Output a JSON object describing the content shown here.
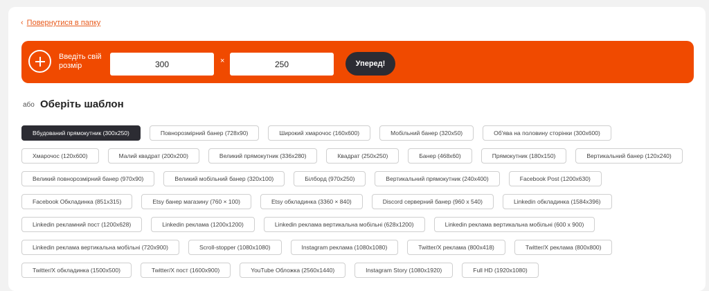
{
  "back_link": {
    "label": "Повернутися в папку",
    "chevron": "‹"
  },
  "custom_size": {
    "label_line1": "Введіть свій",
    "label_line2": "розмір",
    "width": "300",
    "height": "250",
    "separator": "×",
    "submit_label": "Уперед!"
  },
  "or_label": "або",
  "templates_title": "Оберіть шаблон",
  "colors": {
    "accent": "#f04a00",
    "dark": "#2c2c33"
  },
  "templates": [
    {
      "label": "Вбудований прямокутник (300x250)",
      "active": true
    },
    {
      "label": "Повнорозмірний банер (728x90)"
    },
    {
      "label": "Широкий хмарочос (160x600)"
    },
    {
      "label": "Мобільний банер (320x50)"
    },
    {
      "label": "Об'ява на половину сторінки (300x600)"
    },
    {
      "label": "Хмарочос (120x600)"
    },
    {
      "label": "Малий квадрат (200x200)"
    },
    {
      "label": "Великий прямокутник (336x280)"
    },
    {
      "label": "Квадрат (250x250)"
    },
    {
      "label": "Банер (468x60)"
    },
    {
      "label": "Прямокутник (180x150)"
    },
    {
      "label": "Вертикальний банер (120x240)"
    },
    {
      "label": "Великий повнорозмірний банер (970x90)"
    },
    {
      "label": "Великий мобільний банер (320x100)"
    },
    {
      "label": "Білборд (970x250)"
    },
    {
      "label": "Вертикальний прямокутник (240x400)"
    },
    {
      "label": "Facebook Post (1200x630)"
    },
    {
      "label": "Facebook Обкладинка (851x315)"
    },
    {
      "label": "Etsy банер магазину (760 × 100)"
    },
    {
      "label": "Etsy обкладинка (3360 × 840)"
    },
    {
      "label": "Discord серверний банер (960 x 540)"
    },
    {
      "label": "Linkedin обкладинка (1584x396)"
    },
    {
      "label": "Linkedin рекламний пост (1200x628)"
    },
    {
      "label": "Linkedin реклама (1200x1200)"
    },
    {
      "label": "Linkedin реклама вертикальна мобільні (628x1200)"
    },
    {
      "label": "Linkedin реклама вертикальна мобільні (600 x 900)"
    },
    {
      "label": "Linkedin реклама вертикальна мобільні (720x900)"
    },
    {
      "label": "Scroll-stopper (1080x1080)"
    },
    {
      "label": "Instagram реклама (1080x1080)"
    },
    {
      "label": "Twitter/X реклама (800x418)"
    },
    {
      "label": "Twitter/X реклама (800x800)"
    },
    {
      "label": "Twitter/X обкладинка (1500x500)"
    },
    {
      "label": "Twitter/X пост (1600x900)"
    },
    {
      "label": "YouTube Обложка (2560x1440)"
    },
    {
      "label": "Instagram Story (1080x1920)"
    },
    {
      "label": "Full HD (1920x1080)"
    }
  ]
}
